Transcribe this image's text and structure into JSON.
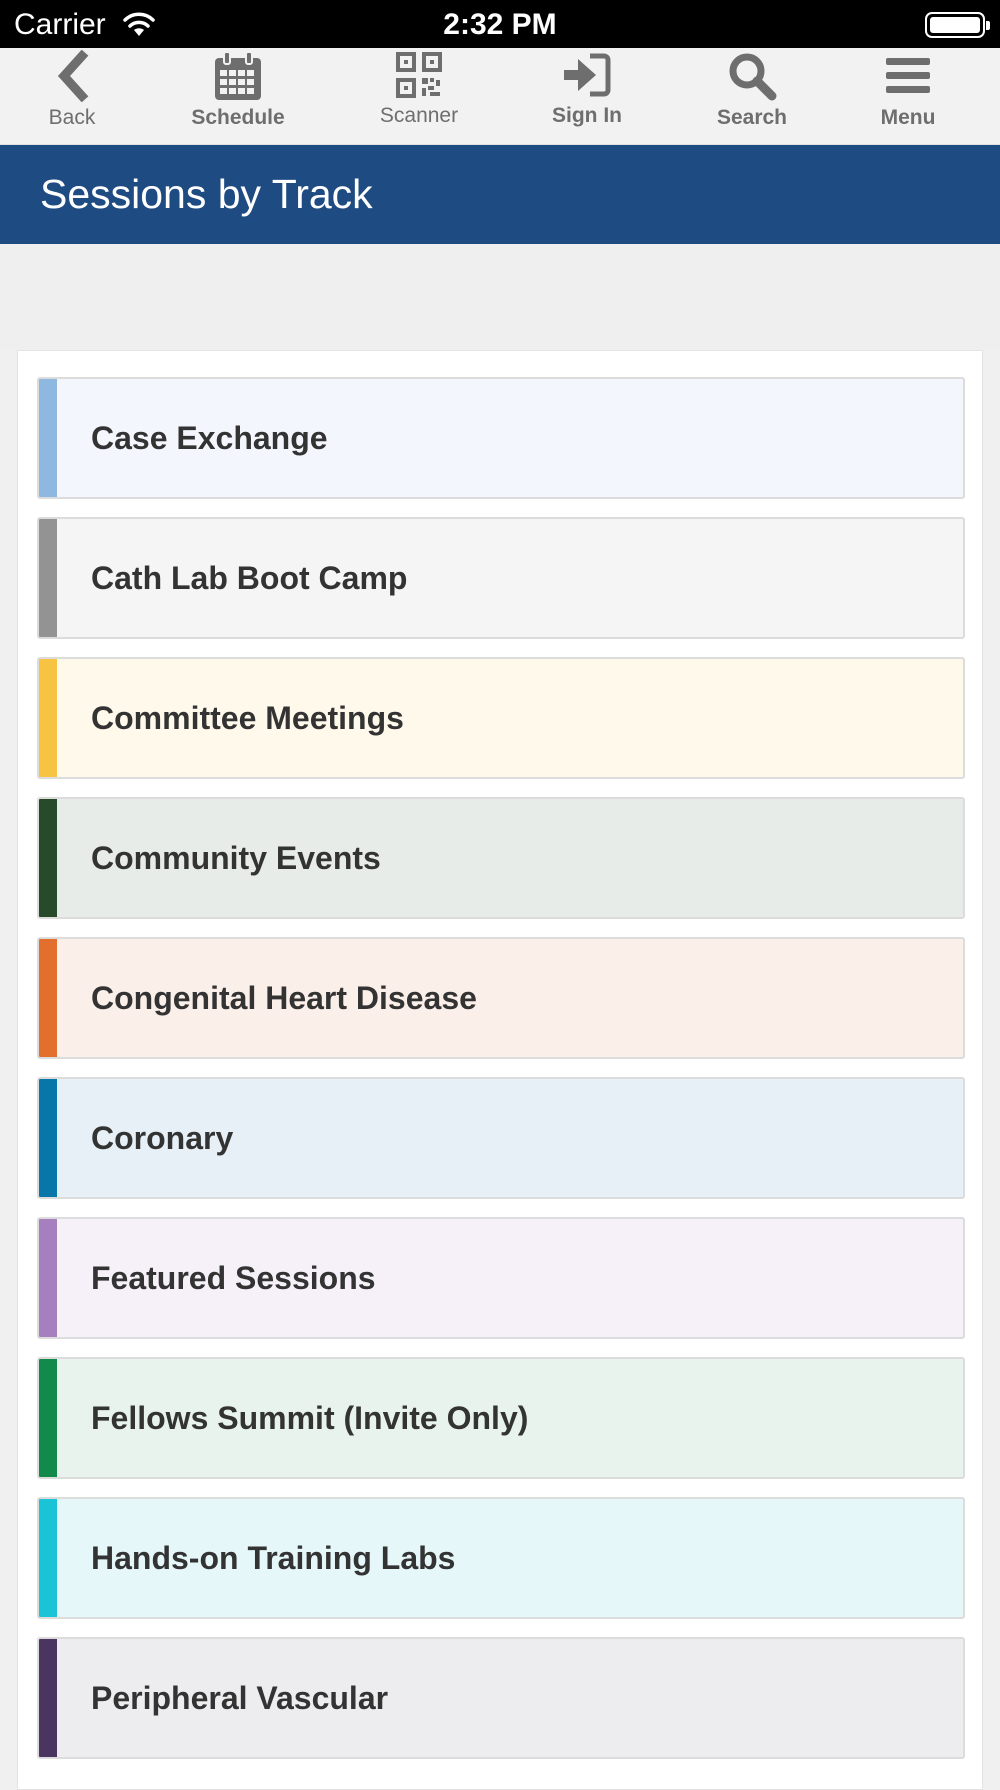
{
  "status_bar": {
    "carrier": "Carrier",
    "time": "2:32 PM"
  },
  "toolbar": {
    "back": "Back",
    "schedule": "Schedule",
    "scanner": "Scanner",
    "sign_in": "Sign In",
    "search": "Search",
    "menu": "Menu"
  },
  "page_title": "Sessions by Track",
  "tracks": [
    {
      "name": "Case Exchange",
      "stripe": "#8fb8e0",
      "bg": "#f3f6fc"
    },
    {
      "name": "Cath Lab Boot Camp",
      "stripe": "#939393",
      "bg": "#f5f5f5"
    },
    {
      "name": "Committee Meetings",
      "stripe": "#f6c343",
      "bg": "#fff9ec"
    },
    {
      "name": "Community Events",
      "stripe": "#264a2a",
      "bg": "#e8ece8"
    },
    {
      "name": "Congenital Heart Disease",
      "stripe": "#e26f2e",
      "bg": "#fbefea"
    },
    {
      "name": "Coronary",
      "stripe": "#0876a8",
      "bg": "#e6f0f6"
    },
    {
      "name": "Featured Sessions",
      "stripe": "#a67fbe",
      "bg": "#f6f1f8"
    },
    {
      "name": "Fellows Summit (Invite Only)",
      "stripe": "#118a4c",
      "bg": "#e7f3ec"
    },
    {
      "name": "Hands-on Training Labs",
      "stripe": "#1bc3d6",
      "bg": "#e6f7fa"
    },
    {
      "name": "Peripheral Vascular",
      "stripe": "#4a3560",
      "bg": "#edecee"
    }
  ]
}
